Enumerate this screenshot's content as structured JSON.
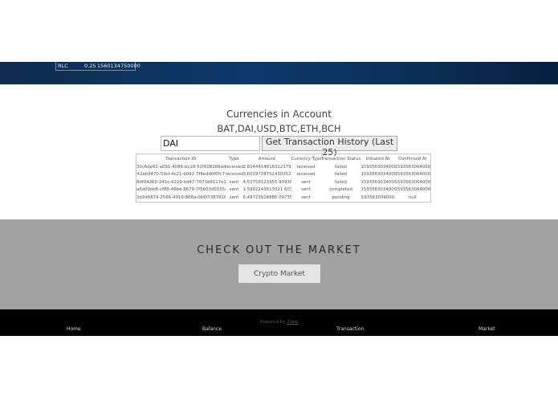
{
  "banner": {
    "rate": {
      "symbol": "RLC",
      "value": "0.25",
      "timestamp": "1560134750000"
    }
  },
  "currencies": {
    "title": "Currencies in Account",
    "list": "BAT,DAI,USD,BTC,ETH,BCH",
    "input_value": "DAI",
    "button_label": "Get Transaction History (Last 25)"
  },
  "transactions": {
    "headers": [
      "Transaction ID",
      "Type",
      "Amount",
      "Currency Type",
      "Transaction Status",
      "Initiated At",
      "Confirmed At"
    ],
    "rows": [
      [
        "30c6de62-a091-4086-bc10-52f608286ada",
        "received",
        "2.8144414816312379",
        "received",
        "failed",
        "1593563034000",
        "1593563064000"
      ],
      [
        "42ab9470-59cf-4c21-b092-7f8edd0f0fc7",
        "received",
        "3.60197287524302529 2",
        "received",
        "failed",
        "1593563034000",
        "1593563064000"
      ],
      [
        "8df04260-241c-4229-bd47-7073e8117e18",
        "sent",
        "4.52758123355 90938",
        "sent",
        "failed",
        "1593563034000",
        "1593563064000"
      ],
      [
        "a6a00de8-cf88-46be-8679-7f5603d0155e",
        "sent",
        "1.5992243613021 6036",
        "sent",
        "completed",
        "1593563034000",
        "1593563064000"
      ],
      [
        "3d3d6879-2566-4916-868a-0b6f73878160",
        "sent",
        "6.48723928886 097357",
        "sent",
        "pending",
        "593563034000",
        "null"
      ]
    ]
  },
  "market": {
    "title": "CHECK OUT THE MARKET",
    "button_label": "Crypto Market"
  },
  "footer": {
    "powered_prefix": "Powered by",
    "powered_link": "Zabo",
    "links": [
      "Home",
      "Balance",
      "Transaction",
      "Market"
    ]
  }
}
